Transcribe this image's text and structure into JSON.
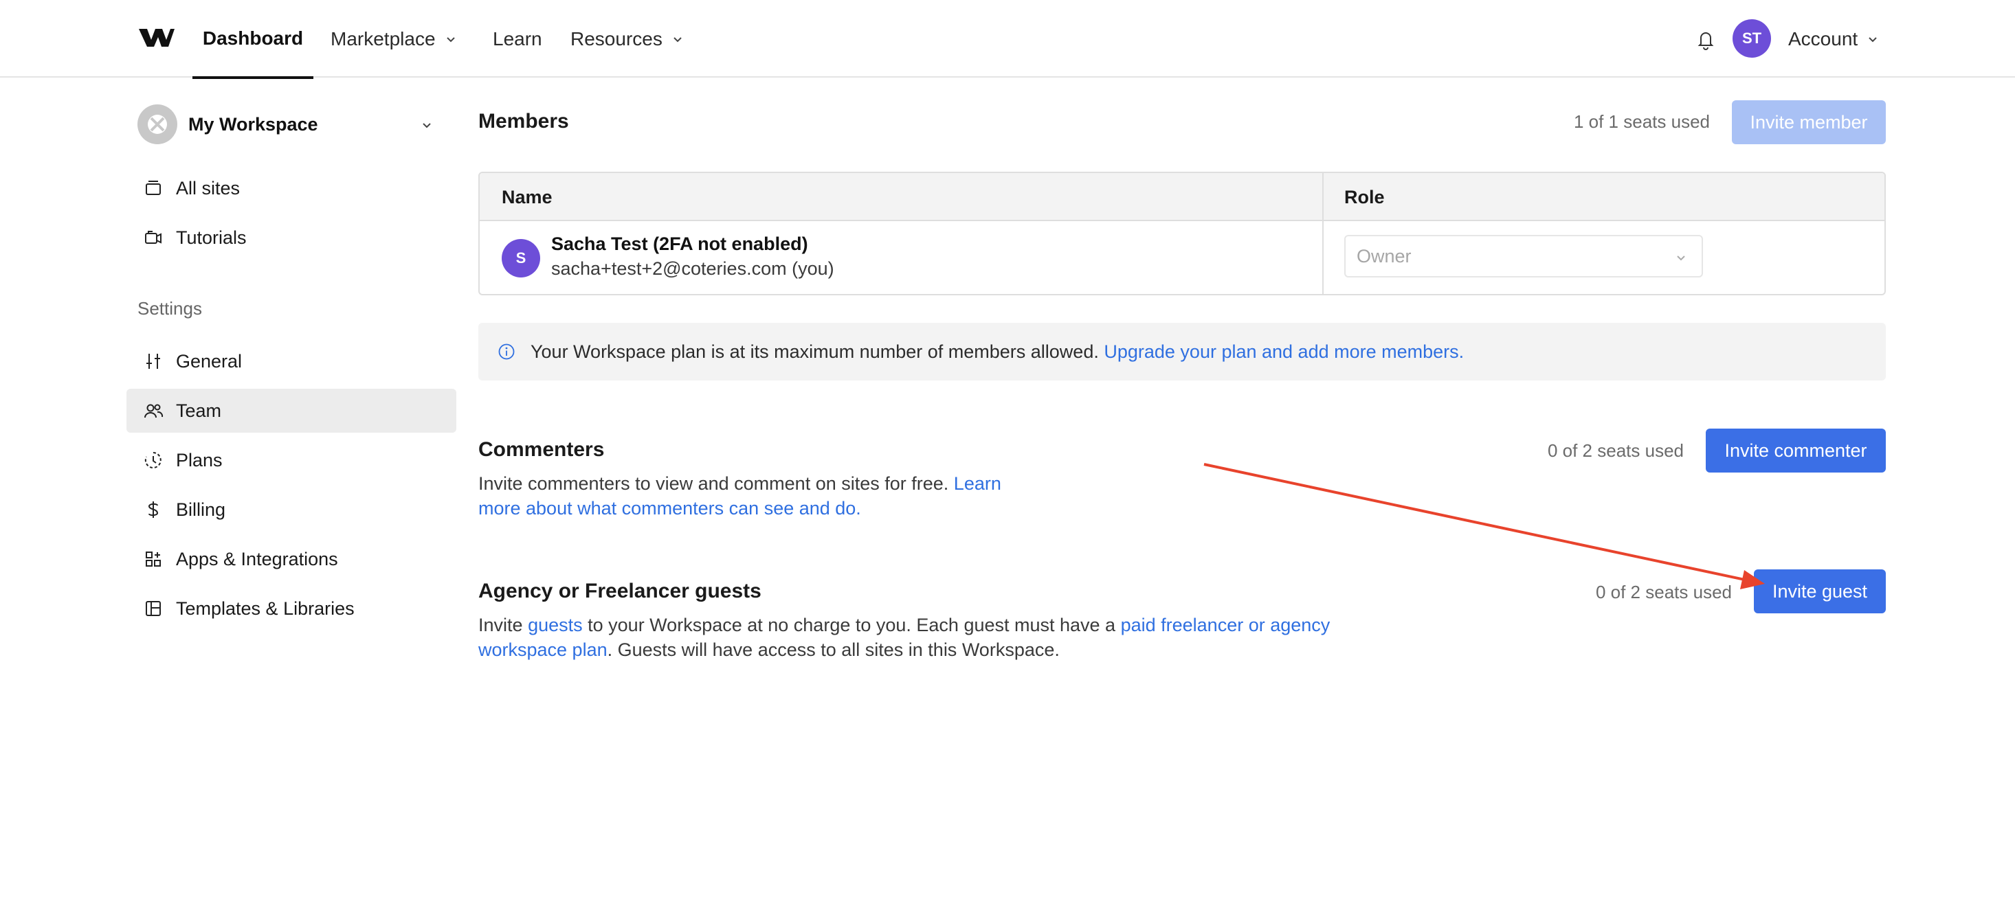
{
  "nav": {
    "logo": "webflow-logo",
    "dashboard": "Dashboard",
    "marketplace": "Marketplace",
    "learn": "Learn",
    "resources": "Resources",
    "avatar_initials": "ST",
    "account": "Account"
  },
  "sidebar": {
    "workspace_name": "My Workspace",
    "all_sites": "All sites",
    "tutorials": "Tutorials",
    "settings_heading": "Settings",
    "general": "General",
    "team": "Team",
    "plans": "Plans",
    "billing": "Billing",
    "apps": "Apps & Integrations",
    "templates": "Templates & Libraries"
  },
  "members": {
    "title": "Members",
    "seats": "1 of 1 seats used",
    "invite_label": "Invite member",
    "col_name": "Name",
    "col_role": "Role",
    "row": {
      "avatar": "S",
      "name": "Sacha Test (2FA not enabled)",
      "email": "sacha+test+2@coteries.com (you)",
      "role": "Owner"
    },
    "notice_text": "Your Workspace plan is at its maximum number of members allowed.",
    "notice_link": "Upgrade your plan and add more members."
  },
  "commenters": {
    "title": "Commenters",
    "seats": "0 of 2 seats used",
    "invite_label": "Invite commenter",
    "desc_text": "Invite commenters to view and comment on sites for free.",
    "desc_link_1": "Learn",
    "desc_link_2": "more about what commenters can see and do."
  },
  "guests": {
    "title": "Agency or Freelancer guests",
    "seats": "0 of 2 seats used",
    "invite_label": "Invite guest",
    "desc_1": "Invite",
    "desc_link_1": "guests",
    "desc_2": "to your Workspace at no charge to you. Each guest must have a",
    "desc_link_2a": "paid freelancer or agency",
    "desc_link_2b": "workspace plan",
    "desc_3": ". Guests will have access to all sites in this Workspace."
  },
  "colors": {
    "accent": "#3b6fe6",
    "accent_disabled": "#a9c1f5",
    "avatar": "#6d4ed8",
    "link": "#2f6fe0",
    "annotation_arrow": "#e8432c"
  }
}
